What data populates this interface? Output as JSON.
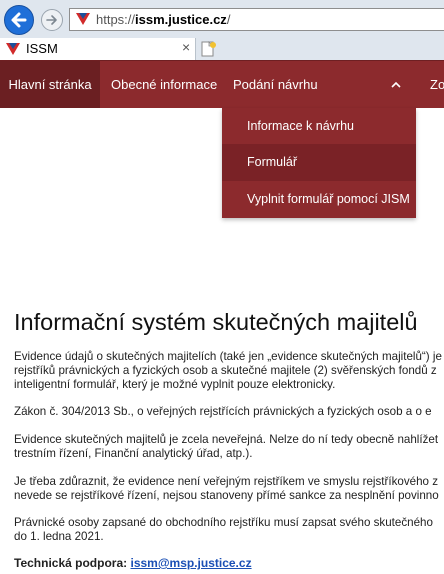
{
  "browser": {
    "url_prefix": "https://",
    "url_host": "issm.justice.cz",
    "url_suffix": "/",
    "tab_title": "ISSM",
    "tab_close": "×"
  },
  "nav": {
    "items": [
      {
        "label": "Hlavní stránka"
      },
      {
        "label": "Obecné informace"
      },
      {
        "label": "Podání návrhu"
      },
      {
        "label": "Zo"
      }
    ],
    "chevron": "^"
  },
  "dropdown": {
    "items": [
      {
        "label": "Informace k návrhu"
      },
      {
        "label": "Formulář"
      },
      {
        "label": "Vyplnit formulář pomocí JISM"
      }
    ]
  },
  "content": {
    "title": "Informační systém skutečných majitelů",
    "p1": [
      "Evidence údajů o skutečných majitelích (také jen „evidence skutečných majitelů“) je",
      "rejstříků právnických a fyzických osob a skutečné majitele (2) svěřenských fondů z",
      "inteligentní formulář, který je možné vyplnit pouze elektronicky."
    ],
    "p2": [
      "Zákon č. 304/2013 Sb., o veřejných rejstřících právnických a fyzických osob a o e"
    ],
    "p3": [
      "Evidence skutečných majitelů je zcela neveřejná. Nelze do ní tedy obecně nahlížet",
      "trestním řízení, Finanční analytický úřad, atp.)."
    ],
    "p4": [
      "Je třeba zdůraznit, že evidence není veřejným rejstříkem ve smyslu rejstříkového z",
      "nevede se rejstříkové řízení, nejsou stanoveny přímé sankce za nesplnění povinno"
    ],
    "p5": [
      "Právnické osoby zapsané do obchodního rejstříku musí zapsat svého skutečného",
      "do 1. ledna 2021."
    ],
    "support_label": "Technická podpora:",
    "support_email": "issm@msp.justice.cz"
  },
  "colors": {
    "nav_bg": "#8c2a2d",
    "nav_active_bg": "#6b1f22",
    "link": "#1a4fb5"
  }
}
